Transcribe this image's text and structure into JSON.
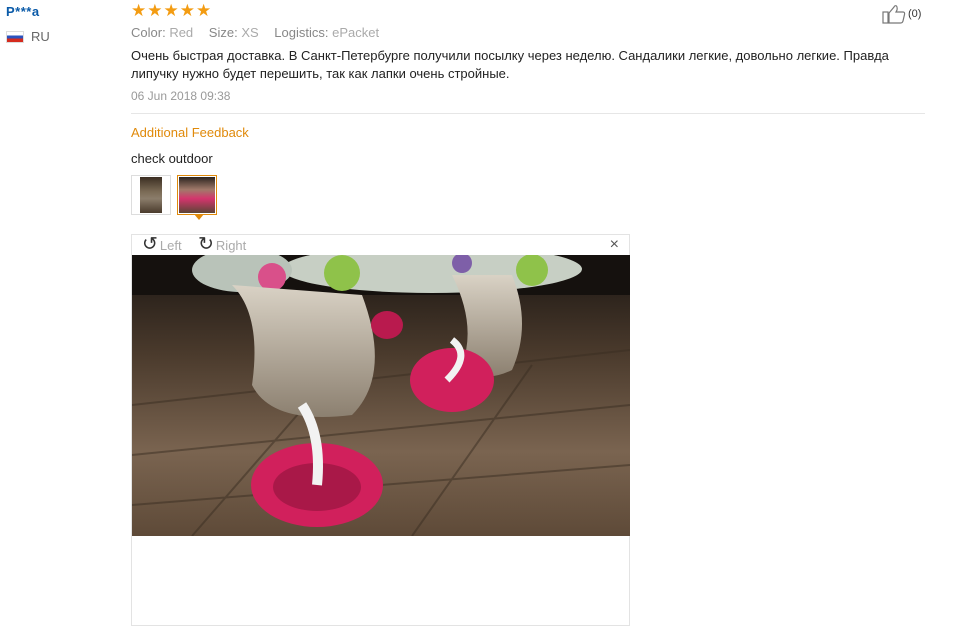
{
  "user": {
    "name": "P***a",
    "country": "RU"
  },
  "review": {
    "stars": "★★★★★",
    "color_label": "Color:",
    "color_value": "Red",
    "size_label": "Size:",
    "size_value": "XS",
    "logistics_label": "Logistics:",
    "logistics_value": "ePacket",
    "text": "Очень быстрая доставка. В Санкт-Петербурге получили посылку через неделю. Сандалики легкие, довольно легкие. Правда липучку нужно будет перешить, так как лапки очень стройные.",
    "date": "06 Jun 2018 09:38",
    "helpful_count": "(0)"
  },
  "additional": {
    "title": "Additional Feedback",
    "text": "check outdoor"
  },
  "viewer": {
    "left_label": "Left",
    "right_label": "Right",
    "close": "×"
  },
  "colors": {
    "accent": "#e08a0b",
    "star": "#f39c12",
    "link": "#0a5aa8"
  }
}
